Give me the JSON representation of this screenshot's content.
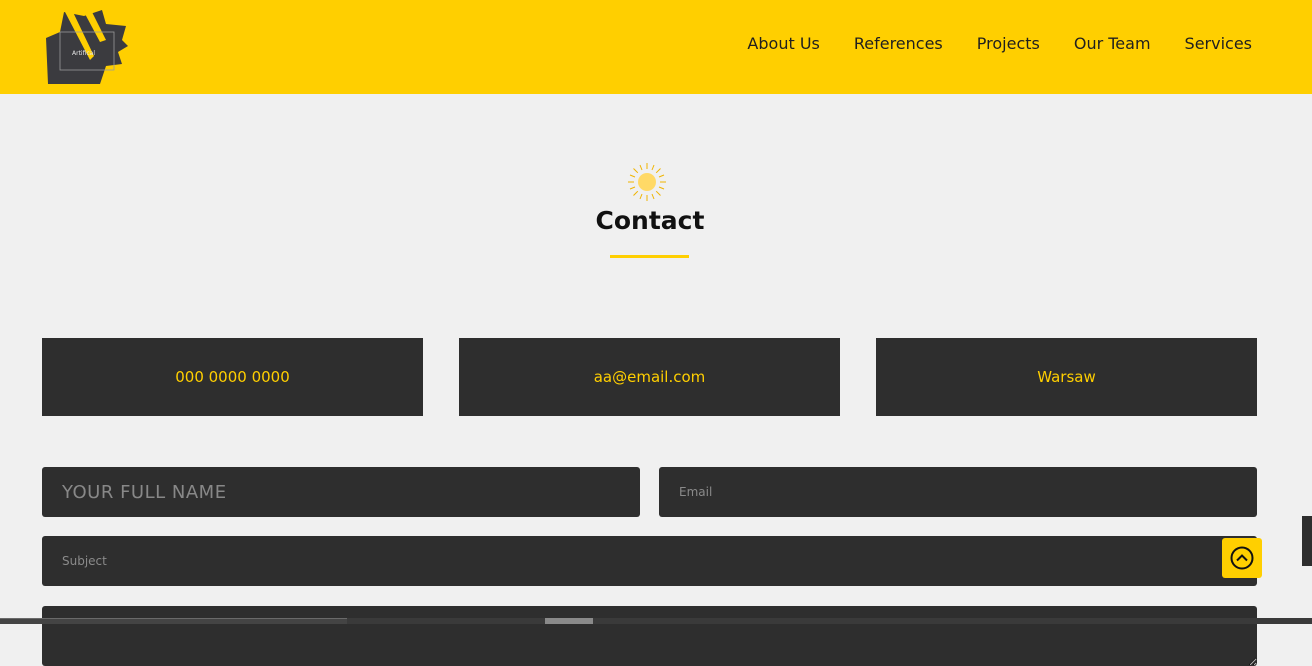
{
  "brand": {
    "logo_text": "Artifical"
  },
  "nav": {
    "items": [
      "About Us",
      "References",
      "Projects",
      "Our Team",
      "Services"
    ]
  },
  "section": {
    "title": "Contact"
  },
  "info": {
    "phone": "000 0000 0000",
    "email": "aa@email.com",
    "city": "Warsaw"
  },
  "form": {
    "name_placeholder": "YOUR FULL NAME",
    "email_placeholder": "Email",
    "subject_placeholder": "Subject",
    "message_placeholder": ""
  },
  "icons": {
    "sun": "sun-icon",
    "scroll_top": "chevron-up-circle-icon"
  },
  "colors": {
    "accent": "#ffcf00",
    "dark": "#2e2e2e",
    "background": "#f0f0f0"
  }
}
